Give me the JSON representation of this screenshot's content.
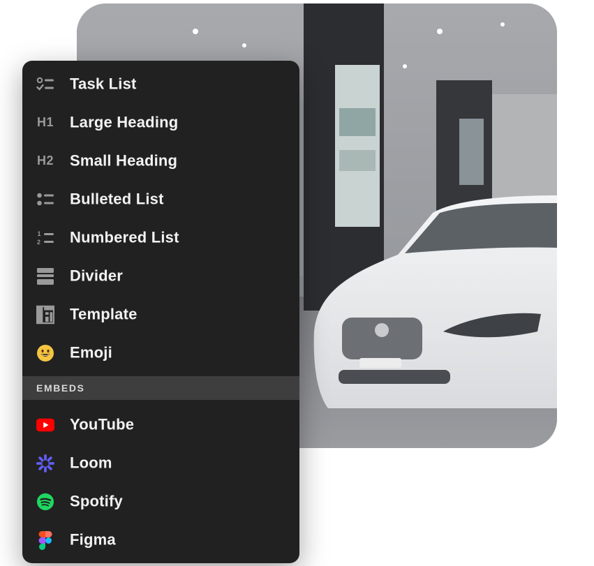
{
  "menu": {
    "items": [
      {
        "label": "Task List",
        "icon": "task-list-icon"
      },
      {
        "label": "Large Heading",
        "icon": "heading-1-icon",
        "icon_text": "H1"
      },
      {
        "label": "Small Heading",
        "icon": "heading-2-icon",
        "icon_text": "H2"
      },
      {
        "label": "Bulleted List",
        "icon": "bulleted-list-icon"
      },
      {
        "label": "Numbered List",
        "icon": "numbered-list-icon"
      },
      {
        "label": "Divider",
        "icon": "divider-icon"
      },
      {
        "label": "Template",
        "icon": "template-icon"
      },
      {
        "label": "Emoji",
        "icon": "emoji-icon"
      }
    ],
    "embeds_section": "EMBEDS",
    "embeds": [
      {
        "label": "YouTube",
        "icon": "youtube-icon"
      },
      {
        "label": "Loom",
        "icon": "loom-icon"
      },
      {
        "label": "Spotify",
        "icon": "spotify-icon"
      },
      {
        "label": "Figma",
        "icon": "figma-icon"
      }
    ]
  },
  "colors": {
    "menu_bg": "#212121",
    "section_bg": "#3e3e3e",
    "text": "#f2f2f2",
    "icon_gray": "#9a9a9a",
    "youtube": "#ff0000",
    "loom": "#625df5",
    "spotify": "#1ed760",
    "emoji": "#f5c542"
  }
}
